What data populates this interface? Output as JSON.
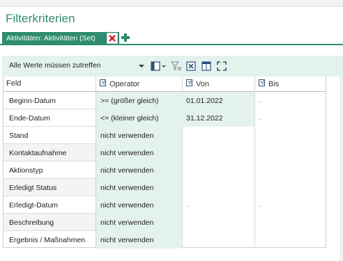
{
  "title": "Filterkriterien",
  "tab": {
    "label": "Aktivitäten: Aktivitäten (Set)"
  },
  "toolbar": {
    "combo_value": "Alle Werte müssen zutreffen"
  },
  "grid": {
    "columns": {
      "feld": "Feld",
      "operator": "Operator",
      "von": "Von",
      "bis": "Bis"
    },
    "rows": [
      {
        "feld": "Beginn-Datum",
        "operator": ">= (größer gleich)",
        "von": "01.01.2022",
        "bis": ".."
      },
      {
        "feld": "Ende-Datum",
        "operator": "<= (kleiner gleich)",
        "von": "31.12.2022",
        "bis": ".."
      },
      {
        "feld": "Stand",
        "operator": "nicht verwenden",
        "von": "",
        "bis": ""
      },
      {
        "feld": "Kontaktaufnahme",
        "operator": "nicht verwenden",
        "von": "",
        "bis": ""
      },
      {
        "feld": "Aktionstyp",
        "operator": "nicht verwenden",
        "von": "",
        "bis": ""
      },
      {
        "feld": "Erledigt Status",
        "operator": "nicht verwenden",
        "von": "",
        "bis": ""
      },
      {
        "feld": "Erledigt-Datum",
        "operator": "nicht verwenden",
        "von": "..",
        "bis": ".."
      },
      {
        "feld": "Beschreibung",
        "operator": "nicht verwenden",
        "von": "",
        "bis": ""
      },
      {
        "feld": "Ergebnis / Maßnahmen",
        "operator": "nicht verwenden",
        "von": "",
        "bis": ""
      }
    ]
  },
  "colors": {
    "accent": "#2f8c6e",
    "light_green": "#e4f2ed",
    "close_red": "#d52020"
  },
  "icons": [
    "close-icon",
    "add-icon",
    "columns-icon",
    "filter-clear-icon",
    "excel-export-icon",
    "table-icon",
    "fit-icon",
    "column-header-icon"
  ]
}
